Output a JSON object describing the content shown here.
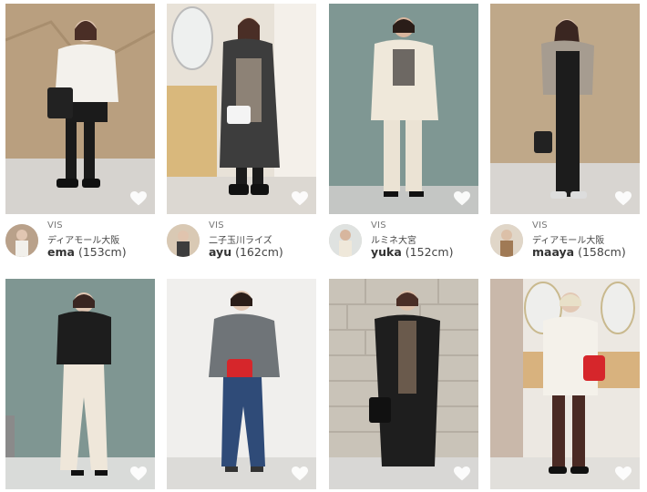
{
  "cards_top": [
    {
      "brand": "VIS",
      "store": "ディアモール大阪",
      "name": "ema",
      "height": "(153cm)"
    },
    {
      "brand": "VIS",
      "store": "二子玉川ライズ",
      "name": "ayu",
      "height": "(162cm)"
    },
    {
      "brand": "VIS",
      "store": "ルミネ大宮",
      "name": "yuka",
      "height": "(152cm)"
    },
    {
      "brand": "VIS",
      "store": "ディアモール大阪",
      "name": "maaya",
      "height": "(158cm)"
    }
  ],
  "icons": {
    "favorite": "heart-outline-icon"
  },
  "colors": {
    "text": "#333333",
    "muted": "#777777",
    "heart": "#ffffff"
  }
}
